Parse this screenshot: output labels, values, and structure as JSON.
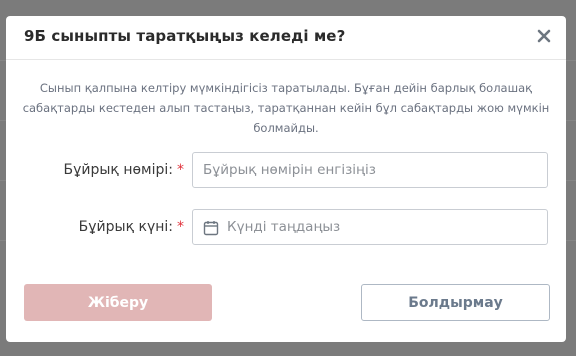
{
  "dialog": {
    "title": "9Б сыныпты таратқыңыз келеді ме?",
    "close_icon": "close-icon",
    "description": "Сынып қалпына келтіру мүмкіндігісіз таратылады. Бұған дейін барлық болашақ сабақтарды кестеден алып тастаңыз, таратқаннан кейін бұл сабақтарды жою мүмкін болмайды."
  },
  "form": {
    "order_number": {
      "label": "Бұйрық нөмірі:",
      "required_mark": "*",
      "value": "",
      "placeholder": "Бұйрық нөмірін енгізіңіз"
    },
    "order_date": {
      "label": "Бұйрық күні:",
      "required_mark": "*",
      "value": "",
      "placeholder": "Күнді таңдаңыз",
      "icon": "calendar-icon"
    }
  },
  "buttons": {
    "submit_label": "Жіберу",
    "cancel_label": "Болдырмау"
  },
  "colors": {
    "submit_bg": "#e1b6b6",
    "required": "#e0313a",
    "cancel_text": "#6b7a8c"
  }
}
